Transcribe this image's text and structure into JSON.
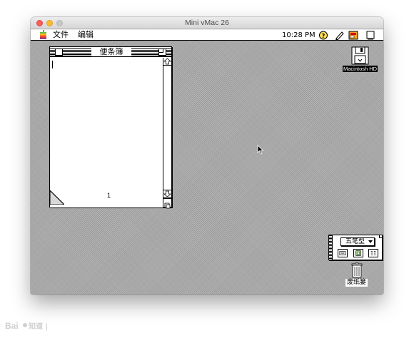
{
  "window": {
    "title": "Mini vMac 26"
  },
  "menubar": {
    "items": [
      {
        "label": "文件"
      },
      {
        "label": "编辑"
      }
    ],
    "clock": "10:28 PM",
    "icons": [
      "apple-icon",
      "help-icon",
      "pencil-icon",
      "application-icon",
      "finder-icon"
    ]
  },
  "notepad": {
    "title": "便条簿",
    "page_number": "1"
  },
  "desktop": {
    "disk": {
      "label": "Macintosh HD",
      "icon": "floppy-disk-icon"
    },
    "trash": {
      "label": "废纸篓",
      "icon": "trash-icon"
    }
  },
  "ime_palette": {
    "selected": "五笔型",
    "buttons": [
      "keyboard-icon",
      "dictionary-icon",
      "settings-icon"
    ]
  },
  "colors": {
    "desktop": "#a9a9a9",
    "close": "#fc5f57",
    "minimize": "#fdbc2e"
  }
}
